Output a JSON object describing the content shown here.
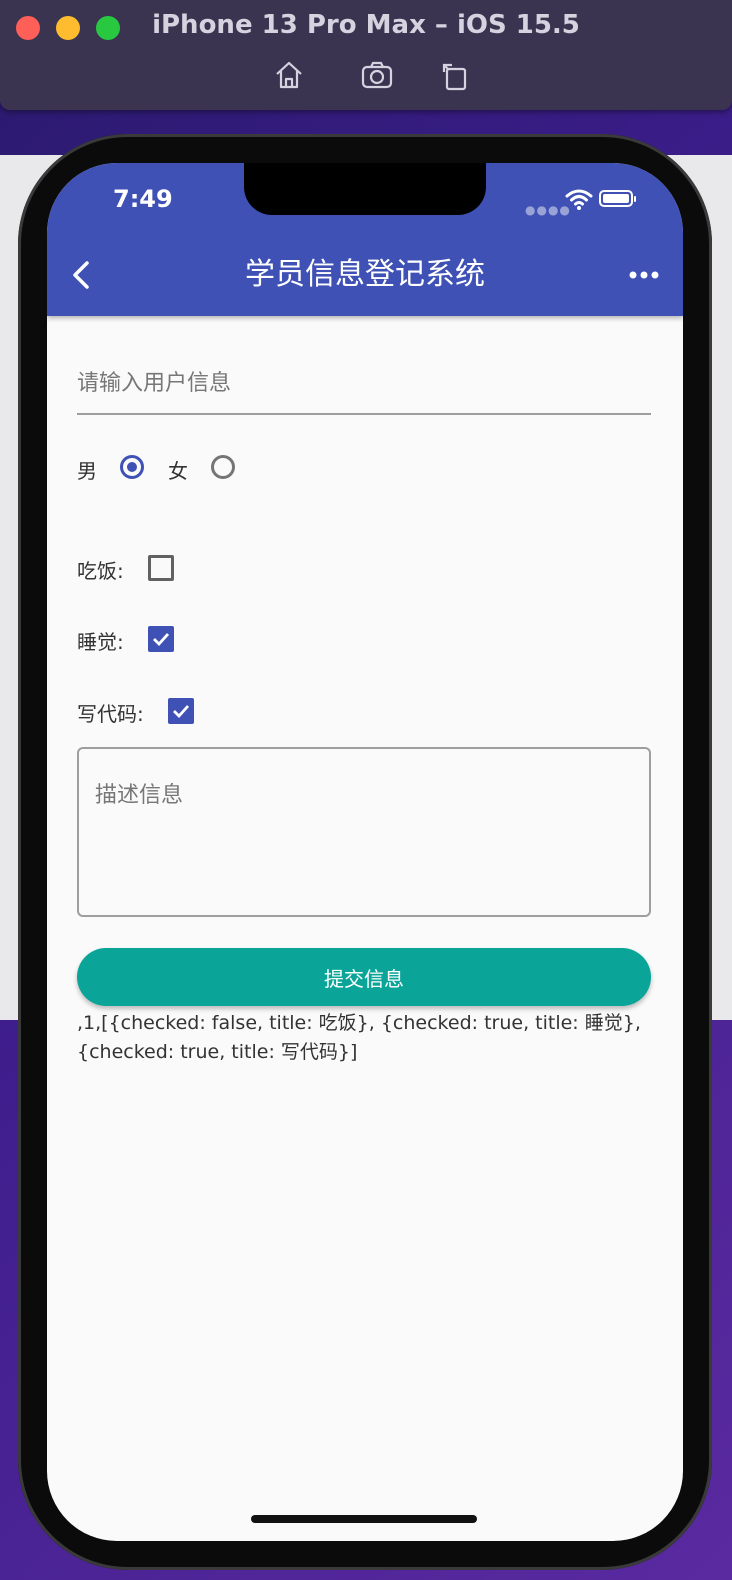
{
  "simulator": {
    "title": "iPhone 13 Pro Max – iOS 15.5",
    "tools": [
      "home-icon",
      "screenshot-icon",
      "rotate-icon"
    ]
  },
  "status_bar": {
    "time": "7:49",
    "icons": [
      "signal-dots-icon",
      "wifi-icon",
      "battery-icon"
    ]
  },
  "app_bar": {
    "title": "学员信息登记系统",
    "back_icon": "chevron-left-icon",
    "more_icon": "more-horizontal-icon",
    "color": "#3f51b5"
  },
  "form": {
    "user_input": {
      "placeholder": "请输入用户信息",
      "value": ""
    },
    "gender": {
      "options": [
        {
          "label": "男",
          "selected": true
        },
        {
          "label": "女",
          "selected": false
        }
      ]
    },
    "hobbies": [
      {
        "label": "吃饭:",
        "checked": false
      },
      {
        "label": "睡觉:",
        "checked": true
      },
      {
        "label": "写代码:",
        "checked": true
      }
    ],
    "description": {
      "placeholder": "描述信息",
      "value": ""
    },
    "submit_label": "提交信息",
    "submit_color": "#0aa598",
    "result_text": ",1,[{checked: false, title: 吃饭}, {checked: true, title: 睡觉}, {checked: true, title: 写代码}]"
  }
}
